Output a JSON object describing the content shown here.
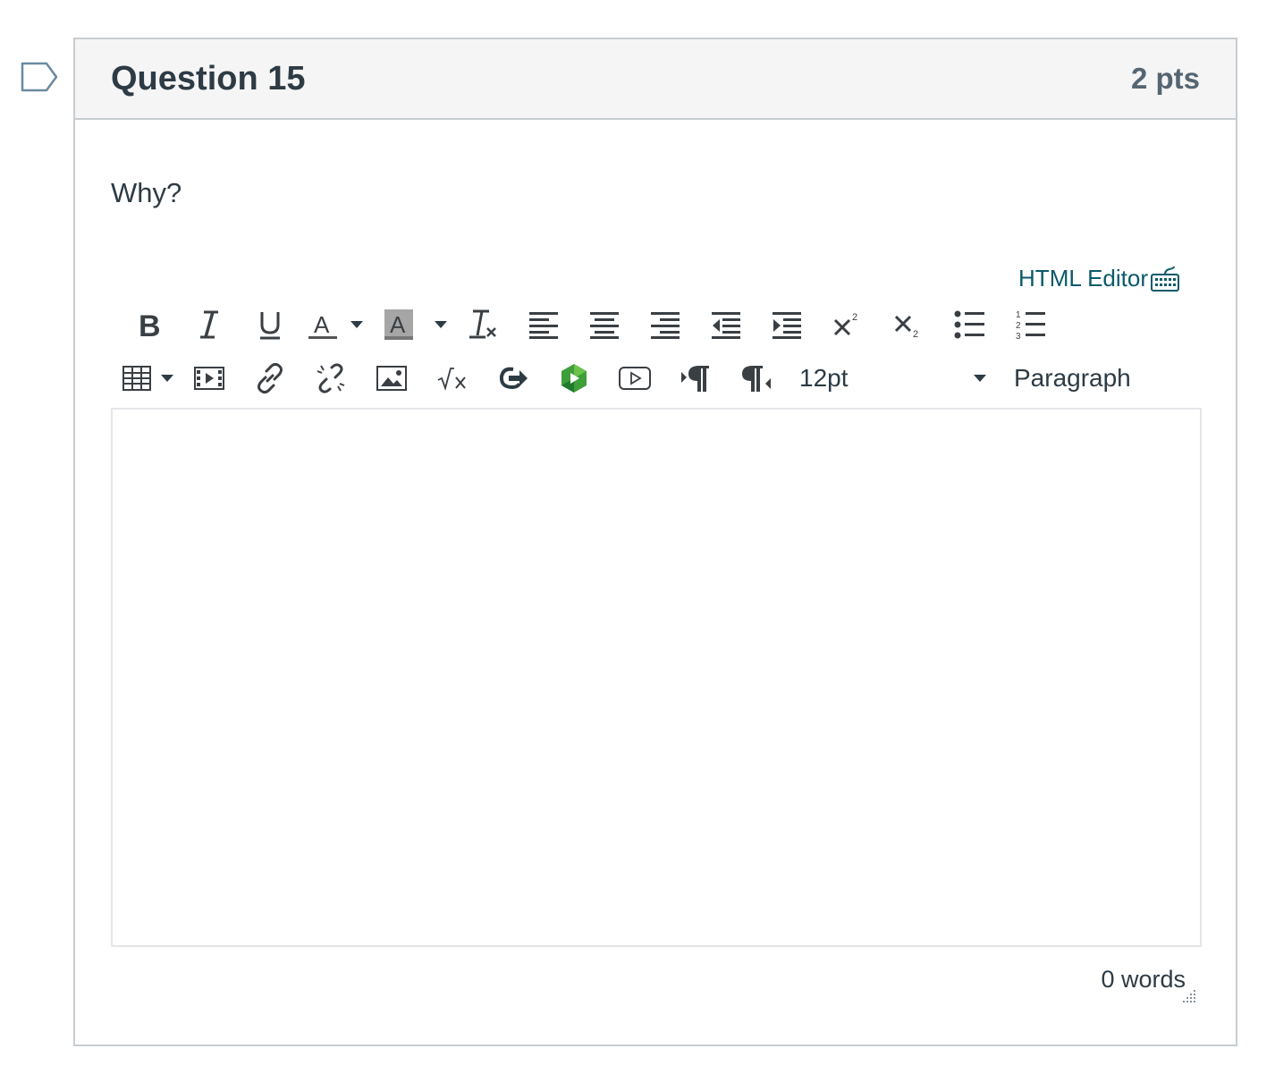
{
  "question": {
    "title": "Question 15",
    "points": "2 pts",
    "text": "Why?",
    "flag_icon": "flag-question-icon"
  },
  "editor": {
    "html_editor_label": "HTML Editor",
    "font_size": "12pt",
    "block_format": "Paragraph",
    "word_count": "0 words",
    "content": ""
  },
  "toolbar": {
    "row1": [
      "bold-icon",
      "italic-icon",
      "underline-icon",
      "text-color-icon",
      "caret-down-icon",
      "background-color-icon",
      "caret-down-icon",
      "clear-formatting-icon",
      "align-left-icon",
      "align-center-icon",
      "align-right-icon",
      "outdent-icon",
      "indent-icon",
      "superscript-icon",
      "subscript-icon",
      "bullet-list-icon",
      "numbered-list-icon"
    ],
    "row2": [
      "table-icon",
      "caret-down-icon",
      "media-icon",
      "link-icon",
      "unlink-icon",
      "image-icon",
      "equation-icon",
      "external-tools-icon",
      "green-app-icon",
      "video-icon",
      "ltr-paragraph-icon",
      "rtl-paragraph-icon"
    ]
  },
  "colors": {
    "border": "#c7cdd1",
    "header_bg": "#f5f5f5",
    "text": "#2d3b45",
    "link": "#0a5a6a"
  }
}
